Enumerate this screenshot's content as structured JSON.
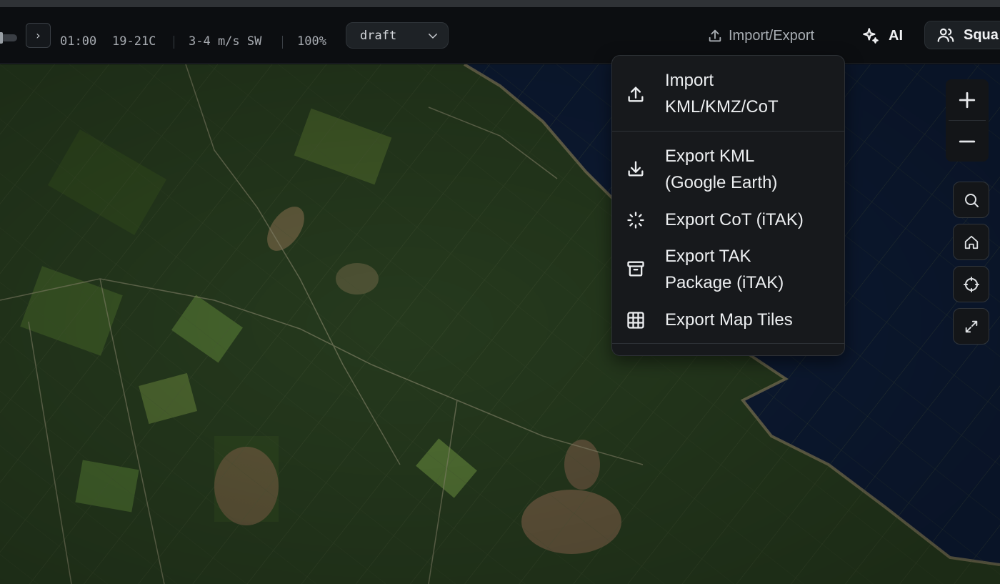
{
  "toolbar": {
    "next_glyph": "›",
    "time": "01:00",
    "temperature": "19-21C",
    "wind": "3-4 m/s SW",
    "zoom": "100%",
    "mode_select": {
      "value": "draft"
    },
    "import_export_label": "Import/Export",
    "ai_label": "AI",
    "squad_label": "Squa"
  },
  "menu": {
    "items": [
      {
        "line1": "Import",
        "line2": "KML/KMZ/CoT",
        "icon": "upload-icon"
      },
      {
        "line1": "Export KML",
        "line2": "(Google Earth)",
        "icon": "download-icon"
      },
      {
        "line1": "Export CoT (iTAK)",
        "line2": "",
        "icon": "loader-icon"
      },
      {
        "line1": "Export TAK",
        "line2": "Package (iTAK)",
        "icon": "archive-icon"
      },
      {
        "line1": "Export Map Tiles",
        "line2": "",
        "icon": "grid-icon"
      }
    ]
  },
  "map_controls": {
    "zoom_in_icon": "plus-icon",
    "zoom_out_icon": "minus-icon",
    "buttons": [
      "search-icon",
      "home-icon",
      "crosshair-icon",
      "expand-icon"
    ]
  },
  "colors": {
    "forest": "#24381c",
    "field": "#3d5a26",
    "water": "#0c1a33",
    "shore": "#8a8060"
  }
}
